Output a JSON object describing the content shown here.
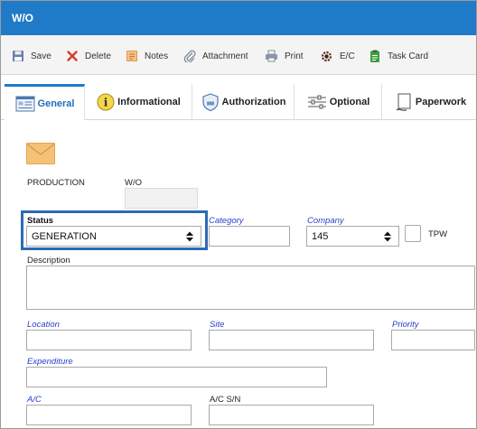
{
  "window": {
    "title": "W/O"
  },
  "toolbar": {
    "save": "Save",
    "delete": "Delete",
    "notes": "Notes",
    "attachment": "Attachment",
    "print": "Print",
    "ec": "E/C",
    "task_card": "Task Card"
  },
  "tabs": {
    "general": "General",
    "informational": "Informational",
    "authorization": "Authorization",
    "optional": "Optional",
    "paperwork": "Paperwork"
  },
  "header": {
    "production": "PRODUCTION",
    "wo_label": "W/O",
    "wo_value": ""
  },
  "fields": {
    "status": {
      "label": "Status",
      "value": "GENERATION"
    },
    "category": {
      "label": "Category",
      "value": ""
    },
    "company": {
      "label": "Company",
      "value": "145"
    },
    "tpw": {
      "label": "TPW"
    },
    "description": {
      "label": "Description",
      "value": ""
    },
    "location": {
      "label": "Location",
      "value": ""
    },
    "site": {
      "label": "Site",
      "value": ""
    },
    "priority": {
      "label": "Priority",
      "value": ""
    },
    "expenditure": {
      "label": "Expenditure",
      "value": ""
    },
    "ac": {
      "label": "A/C",
      "value": ""
    },
    "ac_sn": {
      "label": "A/C S/N",
      "value": ""
    }
  },
  "colors": {
    "titlebar": "#1f7bc8",
    "accent": "#2a6bb5",
    "required_label": "#2a3fcf"
  }
}
